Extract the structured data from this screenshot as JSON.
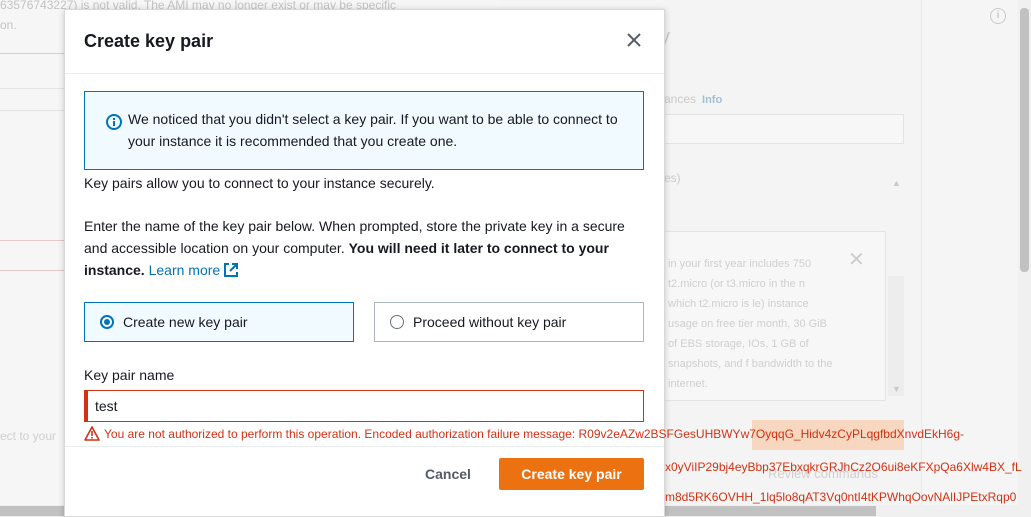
{
  "background": {
    "top_text": "63576743227) is not valid. The AMI may no longer exist or may be specific",
    "top_text_line2": "on.",
    "connect_fragment": "ect to your",
    "letter_y": "y",
    "instances_fragment": "ances",
    "info_link": "Info",
    "es_fragment": "es)",
    "card_text": "in your first year includes 750 t2.micro (or t3.micro in the n which t2.micro is le) instance usage on free tier month, 30 GiB of EBS storage, IOs, 1 GB of snapshots, and f bandwidth to the internet.",
    "review_commands": "Review commands"
  },
  "modal": {
    "title": "Create key pair",
    "alert_text": "We noticed that you didn't select a key pair. If you want to be able to connect to your instance it is recommended that you create one.",
    "intro": "Key pairs allow you to connect to your instance securely.",
    "instructions_part1": "Enter the name of the key pair below. When prompted, store the private key in a secure and accessible location on your computer.",
    "instructions_bold": "You will need it later to connect to your instance.",
    "learn_more": "Learn more",
    "option_create": "Create new key pair",
    "option_proceed": "Proceed without key pair",
    "selected_option": "Create new key pair",
    "field_label": "Key pair name",
    "field_value": "test",
    "error_message": "You are not authorized to perform this operation. Encoded authorization failure message: R09v2eAZw2BSFGesUHBWYw7OyqqG_Hidv4zCyPLqgfbdXnvdEkH6g-",
    "error_overflow_2": "x0yViIP29bj4eyBbp37EbxqkrGRJhCz2O6ui8eKFXpQa6Xlw4BX_fL",
    "error_overflow_3": "m8d5RK6OVHH_1lq5lo8qAT3Vq0ntI4tKPWhqOovNAlIJPEtxRqp0",
    "cancel_label": "Cancel",
    "create_label": "Create key pair"
  },
  "colors": {
    "accent": "#0073bb",
    "error": "#d13212",
    "primary_button": "#ec7211"
  }
}
